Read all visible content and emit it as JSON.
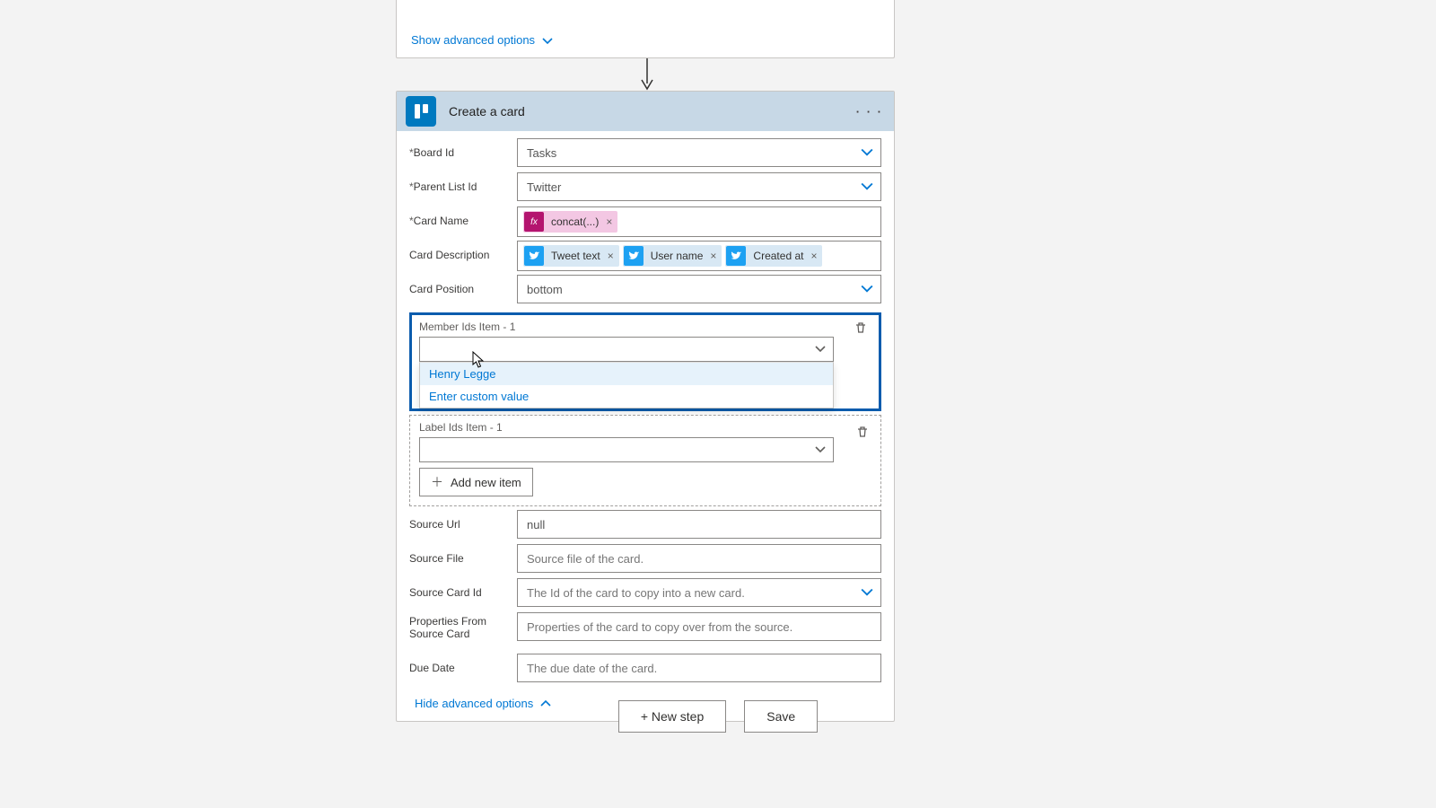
{
  "top_card": {
    "show_advanced": "Show advanced options"
  },
  "action": {
    "title": "Create a card",
    "fields": {
      "board_id": {
        "label": "Board Id",
        "required": "*",
        "value": "Tasks"
      },
      "parent_list_id": {
        "label": "Parent List Id",
        "required": "*",
        "value": "Twitter"
      },
      "card_name": {
        "label": "Card Name",
        "required": "*",
        "tokens": [
          {
            "type": "expr",
            "label": "concat(...)"
          }
        ]
      },
      "card_description": {
        "label": "Card Description",
        "tokens": [
          {
            "type": "twitter",
            "label": "Tweet text"
          },
          {
            "type": "twitter",
            "label": "User name"
          },
          {
            "type": "twitter",
            "label": "Created at"
          }
        ]
      },
      "card_position": {
        "label": "Card Position",
        "value": "bottom"
      },
      "member_ids": {
        "label": "Member Ids Item - 1",
        "options": [
          "Henry Legge",
          "Enter custom value"
        ]
      },
      "label_ids": {
        "label": "Label Ids Item - 1",
        "add_new": "Add new item"
      },
      "source_url": {
        "label": "Source Url",
        "value": "null"
      },
      "source_file": {
        "label": "Source File",
        "placeholder": "Source file of the card."
      },
      "source_card_id": {
        "label": "Source Card Id",
        "placeholder": "The Id of the card to copy into a new card."
      },
      "properties_from_source": {
        "label": "Properties From Source Card",
        "placeholder": "Properties of the card to copy over from the source."
      },
      "due_date": {
        "label": "Due Date",
        "placeholder": "The due date of the card."
      }
    },
    "hide_advanced": "Hide advanced options"
  },
  "footer": {
    "new_step": "+ New step",
    "save": "Save"
  },
  "icons": {
    "trello": "trello-icon",
    "twitter": "twitter-icon",
    "fx": "expr-icon",
    "chevron": "chevron-down-icon",
    "trash": "trash-icon",
    "plus": "plus-icon",
    "more": "more-icon"
  }
}
